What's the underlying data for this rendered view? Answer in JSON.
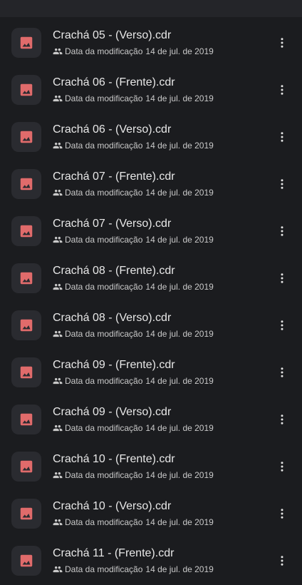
{
  "colors": {
    "background": "#1b1c1f",
    "icon_bg": "#2a2b30",
    "image_icon": "#e06b6b"
  },
  "files": [
    {
      "name": "Crachá 05 - (Verso).cdr",
      "meta_label": "Data da modificação",
      "date": "14 de jul. de 2019",
      "icon": "image-icon"
    },
    {
      "name": "Crachá 06 - (Frente).cdr",
      "meta_label": "Data da modificação",
      "date": "14 de jul. de 2019",
      "icon": "image-icon"
    },
    {
      "name": "Crachá 06 - (Verso).cdr",
      "meta_label": "Data da modificação",
      "date": "14 de jul. de 2019",
      "icon": "image-icon"
    },
    {
      "name": "Crachá 07 - (Frente).cdr",
      "meta_label": "Data da modificação",
      "date": "14 de jul. de 2019",
      "icon": "image-icon"
    },
    {
      "name": "Crachá 07 - (Verso).cdr",
      "meta_label": "Data da modificação",
      "date": "14 de jul. de 2019",
      "icon": "image-icon"
    },
    {
      "name": "Crachá 08 - (Frente).cdr",
      "meta_label": "Data da modificação",
      "date": "14 de jul. de 2019",
      "icon": "image-icon"
    },
    {
      "name": "Crachá 08 - (Verso).cdr",
      "meta_label": "Data da modificação",
      "date": "14 de jul. de 2019",
      "icon": "image-icon"
    },
    {
      "name": "Crachá 09 - (Frente).cdr",
      "meta_label": "Data da modificação",
      "date": "14 de jul. de 2019",
      "icon": "image-icon"
    },
    {
      "name": "Crachá 09 - (Verso).cdr",
      "meta_label": "Data da modificação",
      "date": "14 de jul. de 2019",
      "icon": "image-icon"
    },
    {
      "name": "Crachá 10 - (Frente).cdr",
      "meta_label": "Data da modificação",
      "date": "14 de jul. de 2019",
      "icon": "image-icon"
    },
    {
      "name": "Crachá 10 - (Verso).cdr",
      "meta_label": "Data da modificação",
      "date": "14 de jul. de 2019",
      "icon": "image-icon"
    },
    {
      "name": "Crachá 11 - (Frente).cdr",
      "meta_label": "Data da modificação",
      "date": "14 de jul. de 2019",
      "icon": "image-icon"
    }
  ]
}
